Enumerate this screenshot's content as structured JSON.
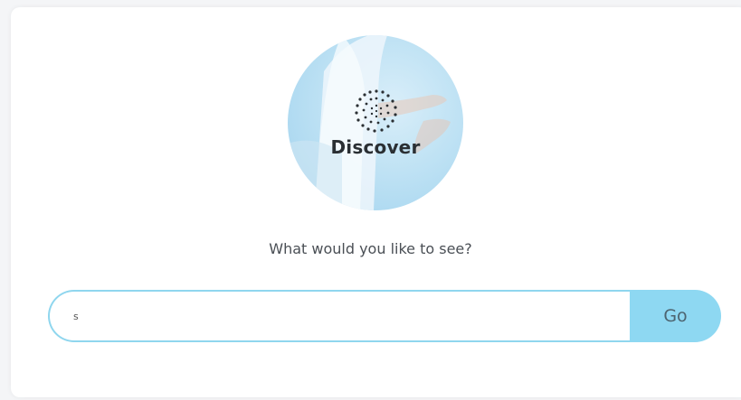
{
  "hero": {
    "label": "Discover",
    "logo_icon": "swirl-dots-logo-icon"
  },
  "prompt": {
    "text": "What would you like to see?"
  },
  "search": {
    "value": "s",
    "placeholder": ""
  },
  "go_button": {
    "label": "Go"
  },
  "colors": {
    "accent": "#8ed8f2",
    "input_border": "#8fd6ee"
  }
}
